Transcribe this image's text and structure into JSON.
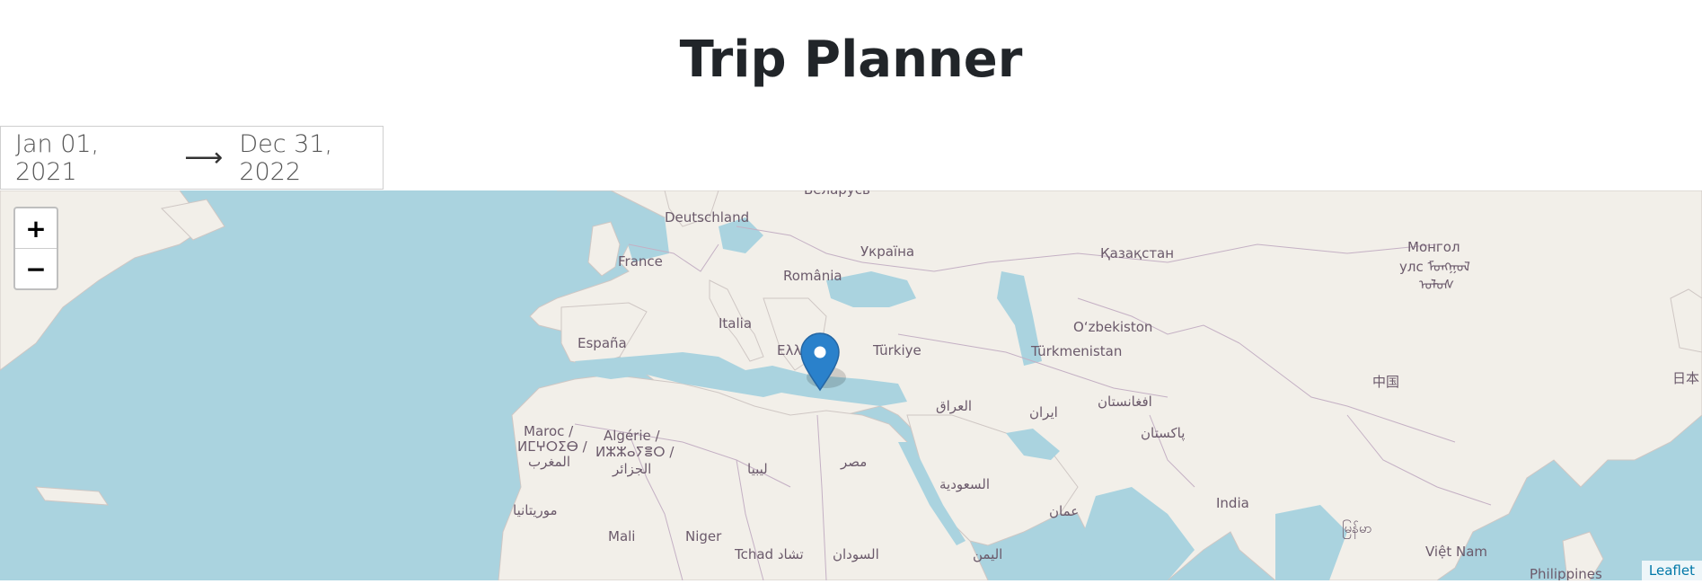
{
  "header": {
    "title": "Trip Planner"
  },
  "date_range": {
    "start": "Jan 01, 2021",
    "arrow": "⟶",
    "end": "Dec 31, 2022"
  },
  "map": {
    "zoom_in_label": "+",
    "zoom_out_label": "−",
    "attribution": "Leaflet",
    "marker": {
      "location": "Crete, Greece"
    },
    "labels": {
      "deutschland": "Deutschland",
      "france": "France",
      "espana": "España",
      "italia": "Italia",
      "romania": "România",
      "ukraine": "Україна",
      "turkiye": "Türkiye",
      "greece": "Ελλ",
      "kazakhstan": "Қазақстан",
      "uzbekistan": "O‘zbekiston",
      "turkmenistan": "Türkmenistan",
      "mongolia_1": "Монгол",
      "mongolia_2": "улс ᠮᠣᠩᠭᠣᠯ",
      "mongolia_3": "ᠤᠯᠤᠰ",
      "china": "中国",
      "japan": "日本",
      "iraq": "العراق",
      "iran": "ایران",
      "afghanistan": "افغانستان",
      "pakistan": "پاکستان",
      "india": "India",
      "morocco_1": "Maroc /",
      "morocco_2": "ⵍⵎⵖⵔⵉⴱ /",
      "morocco_3": "المغرب",
      "algeria_1": "Algérie /",
      "algeria_2": "ⵍⵣⵣⴰⵢⴻⵔ /",
      "algeria_3": "الجزائر",
      "libya": "ليبيا",
      "egypt": "مصر",
      "saudi": "السعودية",
      "oman": "عمان",
      "mauritania": "موريتانيا",
      "mali": "Mali",
      "niger": "Niger",
      "chad": "Tchad تشاد",
      "sudan": "السودان",
      "yemen": "اليمن",
      "myanmar": "မြန်မာ",
      "vietnam": "Việt Nam",
      "philippines": "Philippines",
      "belarus": "Беларусь"
    }
  }
}
